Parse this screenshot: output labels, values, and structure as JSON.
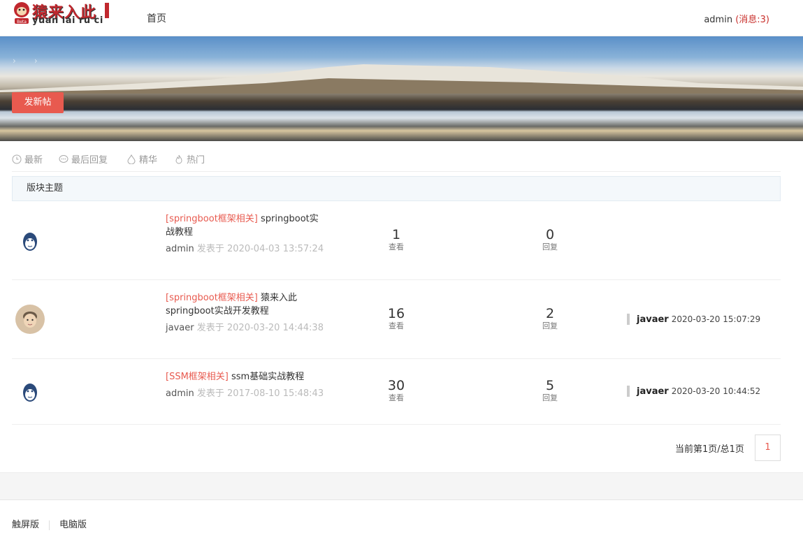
{
  "header": {
    "logo_cn": "猿来入此",
    "logo_en": "yuan lai ru ci",
    "nav_home": "首页",
    "user_name": "admin",
    "message_label": "(消息:3)"
  },
  "banner": {
    "new_post_label": "发新帖"
  },
  "filters": [
    {
      "label": "最新",
      "icon": "clock-icon"
    },
    {
      "label": "最后回复",
      "icon": "chat-bubble-icon"
    },
    {
      "label": "精华",
      "icon": "drop-icon"
    },
    {
      "label": "热门",
      "icon": "flame-icon"
    }
  ],
  "section_title": "版块主题",
  "threads": [
    {
      "category": "[springboot框架相关]",
      "title": "springboot实战教程",
      "author": "admin",
      "posted_prefix": "发表于",
      "posted_at": "2020-04-03 13:57:24",
      "views": "1",
      "views_label": "查看",
      "replies": "0",
      "replies_label": "回复",
      "last_user": "",
      "last_time": "",
      "avatar": "monkey-avatar-icon"
    },
    {
      "category": "[springboot框架相关]",
      "title": "猿来入此springboot实战开发教程",
      "author": "javaer",
      "posted_prefix": "发表于",
      "posted_at": "2020-03-20 14:44:38",
      "views": "16",
      "views_label": "查看",
      "replies": "2",
      "replies_label": "回复",
      "last_user": "javaer",
      "last_time": "2020-03-20 15:07:29",
      "avatar": "user-photo-avatar"
    },
    {
      "category": "[SSM框架相关]",
      "title": "ssm基础实战教程",
      "author": "admin",
      "posted_prefix": "发表于",
      "posted_at": "2017-08-10 15:48:43",
      "views": "30",
      "views_label": "查看",
      "replies": "5",
      "replies_label": "回复",
      "last_user": "javaer",
      "last_time": "2020-03-20 10:44:52",
      "avatar": "monkey-avatar-icon"
    }
  ],
  "pager": {
    "status": "当前第1页/总1页",
    "current": "1"
  },
  "footer": {
    "touch": "触屏版",
    "desktop": "电脑版"
  },
  "colors": {
    "accent": "#e85a4f",
    "brand_red": "#c0282e"
  }
}
